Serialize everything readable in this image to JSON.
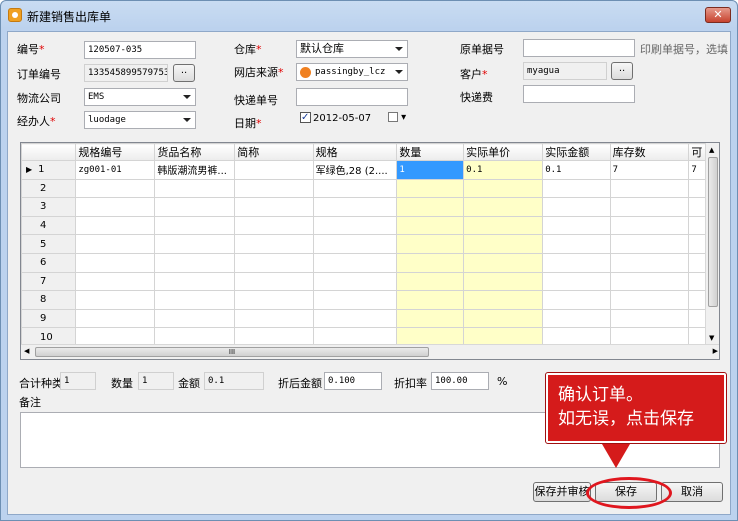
{
  "window": {
    "title": "新建销售出库单"
  },
  "form": {
    "code_label": "编号",
    "code_value": "120507-035",
    "order_no_label": "订单编号",
    "order_no_value": "133545899579753",
    "logistics_label": "物流公司",
    "logistics_value": "EMS",
    "handler_label": "经办人",
    "handler_value": "luodage",
    "warehouse_label": "仓库",
    "warehouse_value": "默认仓库",
    "shop_source_label": "网店来源",
    "shop_source_value": "passingby_lcz",
    "express_no_label": "快递单号",
    "express_no_value": "",
    "date_label": "日期",
    "date_value": "2012-05-07",
    "orig_doc_label": "原单据号",
    "orig_doc_value": "",
    "print_note": "印刷单据号，选填",
    "customer_label": "客户",
    "customer_value": "myagua",
    "express_fee_label": "快递费",
    "express_fee_value": "",
    "browse_btn": "..",
    "required_mark": "*"
  },
  "grid": {
    "columns": [
      "规格编号",
      "货品名称",
      "简称",
      "规格",
      "数量",
      "实际单价",
      "实际金额",
      "库存数",
      "可"
    ],
    "rows": [
      {
        "no": "1",
        "cells": [
          "zg001-01",
          "韩版潮流男裤...",
          "",
          "军绿色,28 (2....",
          "1",
          "0.1",
          "0.1",
          "7",
          "7"
        ]
      },
      {
        "no": "2",
        "cells": [
          "",
          "",
          "",
          "",
          "",
          "",
          "",
          "",
          ""
        ]
      },
      {
        "no": "3",
        "cells": [
          "",
          "",
          "",
          "",
          "",
          "",
          "",
          "",
          ""
        ]
      },
      {
        "no": "4",
        "cells": [
          "",
          "",
          "",
          "",
          "",
          "",
          "",
          "",
          ""
        ]
      },
      {
        "no": "5",
        "cells": [
          "",
          "",
          "",
          "",
          "",
          "",
          "",
          "",
          ""
        ]
      },
      {
        "no": "6",
        "cells": [
          "",
          "",
          "",
          "",
          "",
          "",
          "",
          "",
          ""
        ]
      },
      {
        "no": "7",
        "cells": [
          "",
          "",
          "",
          "",
          "",
          "",
          "",
          "",
          ""
        ]
      },
      {
        "no": "8",
        "cells": [
          "",
          "",
          "",
          "",
          "",
          "",
          "",
          "",
          ""
        ]
      },
      {
        "no": "9",
        "cells": [
          "",
          "",
          "",
          "",
          "",
          "",
          "",
          "",
          ""
        ]
      },
      {
        "no": "10",
        "cells": [
          "",
          "",
          "",
          "",
          "",
          "",
          "",
          "",
          ""
        ]
      }
    ],
    "row_pointer": "▶",
    "hscroll_grip": "III"
  },
  "summary": {
    "kinds_label": "合计种类",
    "kinds_value": "1",
    "qty_label": "数量",
    "qty_value": "1",
    "amount_label": "金额",
    "amount_value": "0.1",
    "discounted_label": "折后金额",
    "discounted_value": "0.100",
    "rate_label": "折扣率",
    "rate_value": "100.00",
    "percent": "%",
    "remark_label": "备注"
  },
  "buttons": {
    "save_audit": "保存并审核",
    "save": "保存",
    "cancel": "取消"
  },
  "callout": {
    "line1": "确认订单。",
    "line2": "如无误，点击保存"
  },
  "colors": {
    "editable_cell": "#ffffc8",
    "selected_cell": "#3399ff",
    "callout_bg": "#d51b1b",
    "required": "#e00000"
  }
}
